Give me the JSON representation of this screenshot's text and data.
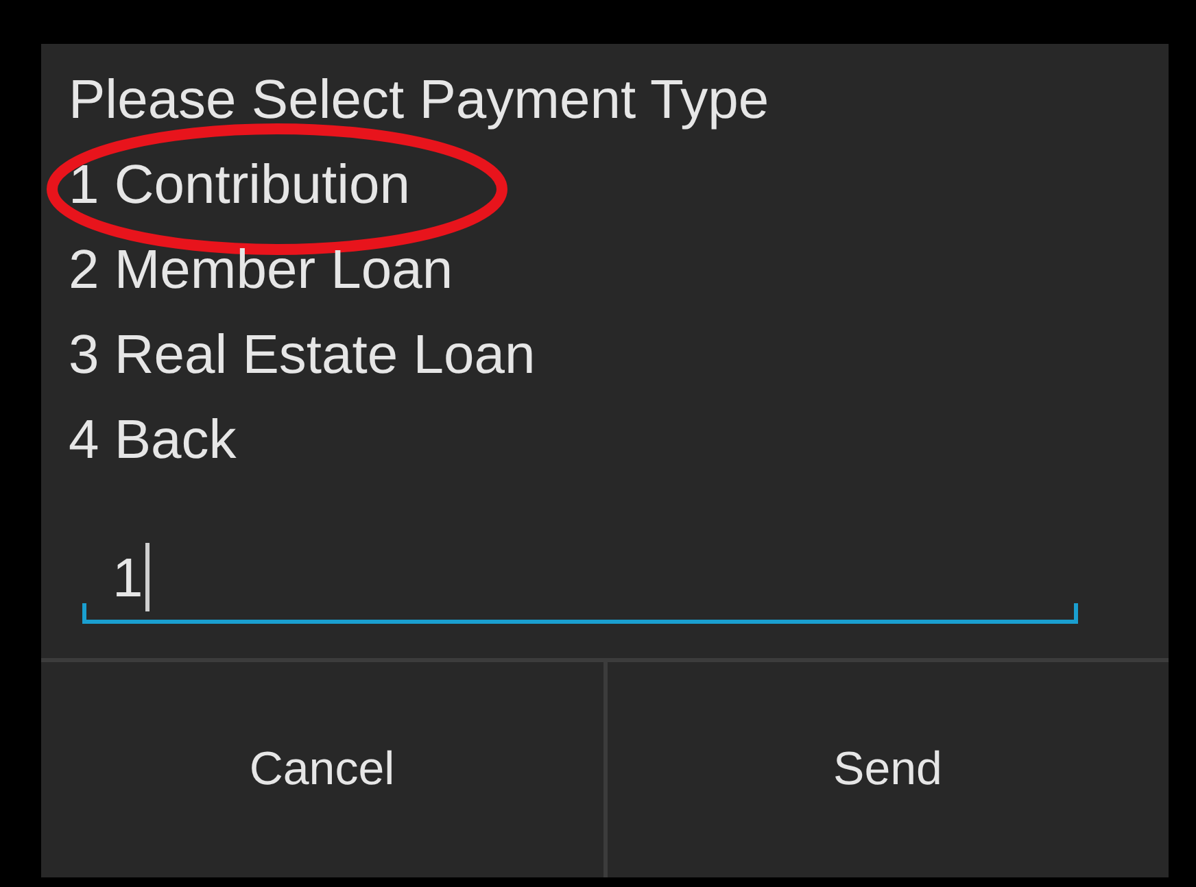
{
  "dialog": {
    "message_title": "Please Select Payment Type",
    "options": [
      {
        "text": "1 Contribution",
        "highlighted": true
      },
      {
        "text": "2 Member Loan",
        "highlighted": false
      },
      {
        "text": "3 Real Estate Loan",
        "highlighted": false
      },
      {
        "text": "4 Back",
        "highlighted": false
      }
    ],
    "input": {
      "value": "1"
    },
    "buttons": [
      "Cancel",
      "Send"
    ]
  }
}
